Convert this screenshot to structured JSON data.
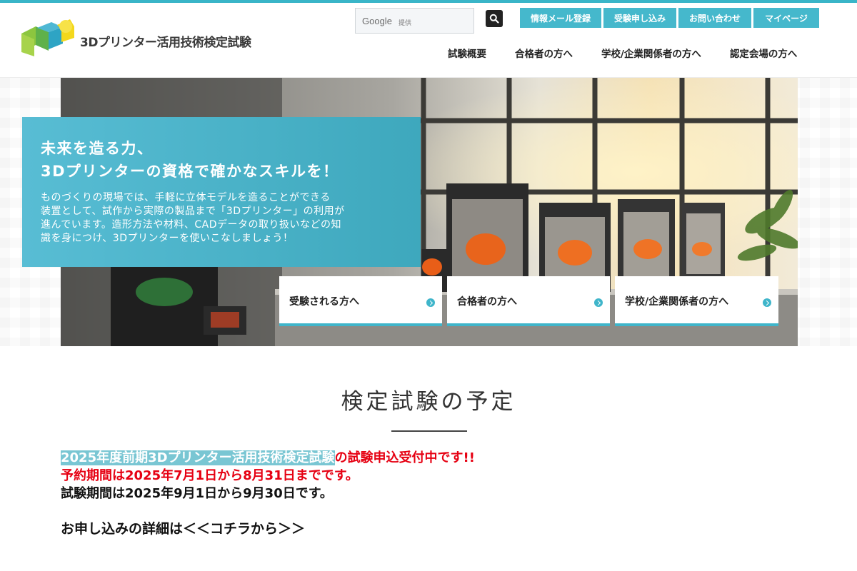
{
  "header": {
    "logo_text": "3Dプリンター活用技術検定試験",
    "search": {
      "brand": "Google",
      "sub": "提供"
    },
    "top_buttons": [
      {
        "label": "情報メール登録"
      },
      {
        "label": "受験申し込み"
      },
      {
        "label": "お問い合わせ"
      },
      {
        "label": "マイページ"
      }
    ],
    "nav": [
      {
        "label": "試験概要"
      },
      {
        "label": "合格者の方へ"
      },
      {
        "label": "学校/企業関係者の方へ"
      },
      {
        "label": "認定会場の方へ"
      }
    ]
  },
  "hero": {
    "title_line1": "未来を造る力、",
    "title_line2": "3Dプリンターの資格で確かなスキルを！",
    "body_lines": [
      "ものづくりの現場では、手軽に立体モデルを造ることができる",
      "装置として、試作から実際の製品まで「3Dプリンター」の利用が",
      "進んでいます。造形方法や材料、CADデータの取り扱いなどの知",
      "識を身につけ、3Dプリンターを使いこなしましょう！"
    ],
    "links": [
      {
        "label": "受験される方へ"
      },
      {
        "label": "合格者の方へ"
      },
      {
        "label": "学校/企業関係者の方へ"
      }
    ]
  },
  "schedule": {
    "heading": "検定試験の予定",
    "line1_highlight": "2025年度前期3Dプリンター活用技術検定試験",
    "line1_rest": "の試験申込受付中です!!",
    "line2": "予約期間は2025年7月1日から8月31日までです。",
    "line3": "試験期間は2025年9月1日から9月30日です。",
    "detail_link": "お申し込みの詳細は＜＜コチラから＞＞"
  },
  "colors": {
    "accent": "#45b8cc",
    "alert_red": "#e60012",
    "highlight": "#79c6d3"
  }
}
